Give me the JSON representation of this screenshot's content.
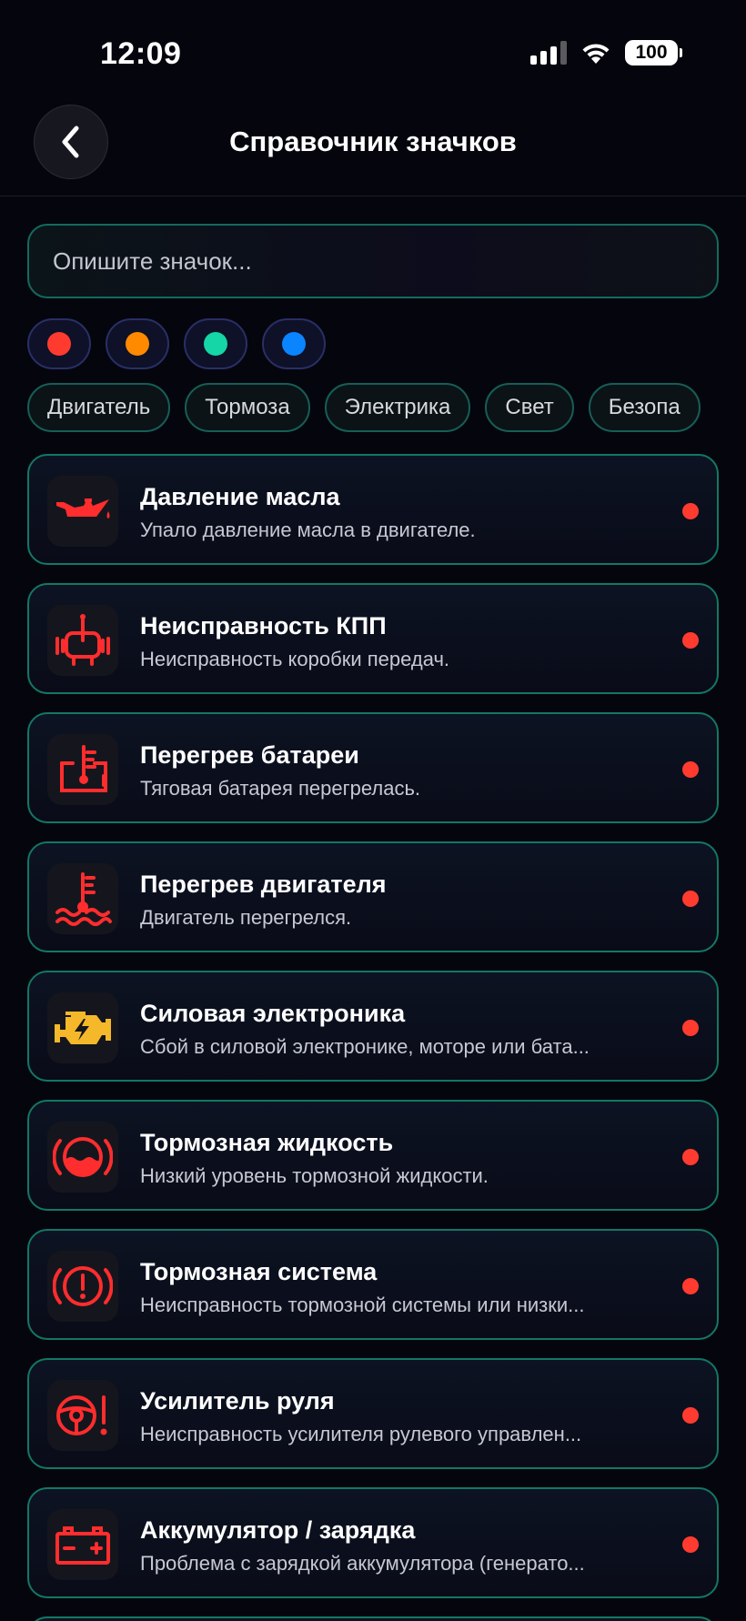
{
  "status_bar": {
    "time": "12:09",
    "battery": "100"
  },
  "header": {
    "title": "Справочник значков"
  },
  "search": {
    "placeholder": "Опишите значок...",
    "value": ""
  },
  "color_filters": [
    {
      "name": "red",
      "color": "#ff3b30"
    },
    {
      "name": "orange",
      "color": "#ff8a00"
    },
    {
      "name": "teal",
      "color": "#15d6a6"
    },
    {
      "name": "blue",
      "color": "#0a84ff"
    }
  ],
  "categories": [
    "Двигатель",
    "Тормоза",
    "Электрика",
    "Свет",
    "Безопа"
  ],
  "items": [
    {
      "title": "Давление масла",
      "desc": "Упало давление масла в двигателе.",
      "icon": "oil-can-icon",
      "severity_color": "#ff3b30"
    },
    {
      "title": "Неисправность КПП",
      "desc": "Неисправность коробки передач.",
      "icon": "transmission-icon",
      "severity_color": "#ff3b30"
    },
    {
      "title": "Перегрев батареи",
      "desc": "Тяговая батарея перегрелась.",
      "icon": "battery-temperature-icon",
      "severity_color": "#ff3b30"
    },
    {
      "title": "Перегрев двигателя",
      "desc": "Двигатель перегрелся.",
      "icon": "coolant-temperature-icon",
      "severity_color": "#ff3b30"
    },
    {
      "title": "Силовая электроника",
      "desc": "Сбой в силовой электронике, моторе или бата...",
      "icon": "engine-lightning-icon",
      "severity_color": "#ff3b30"
    },
    {
      "title": "Тормозная жидкость",
      "desc": "Низкий уровень тормозной жидкости.",
      "icon": "brake-fluid-icon",
      "severity_color": "#ff3b30"
    },
    {
      "title": "Тормозная система",
      "desc": "Неисправность тормозной системы или низки...",
      "icon": "brake-warning-icon",
      "severity_color": "#ff3b30"
    },
    {
      "title": "Усилитель руля",
      "desc": "Неисправность усилителя рулевого управлен...",
      "icon": "steering-warning-icon",
      "severity_color": "#ff3b30"
    },
    {
      "title": "Аккумулятор / зарядка",
      "desc": "Проблема с зарядкой аккумулятора (генерато...",
      "icon": "car-battery-icon",
      "severity_color": "#ff3b30"
    }
  ]
}
